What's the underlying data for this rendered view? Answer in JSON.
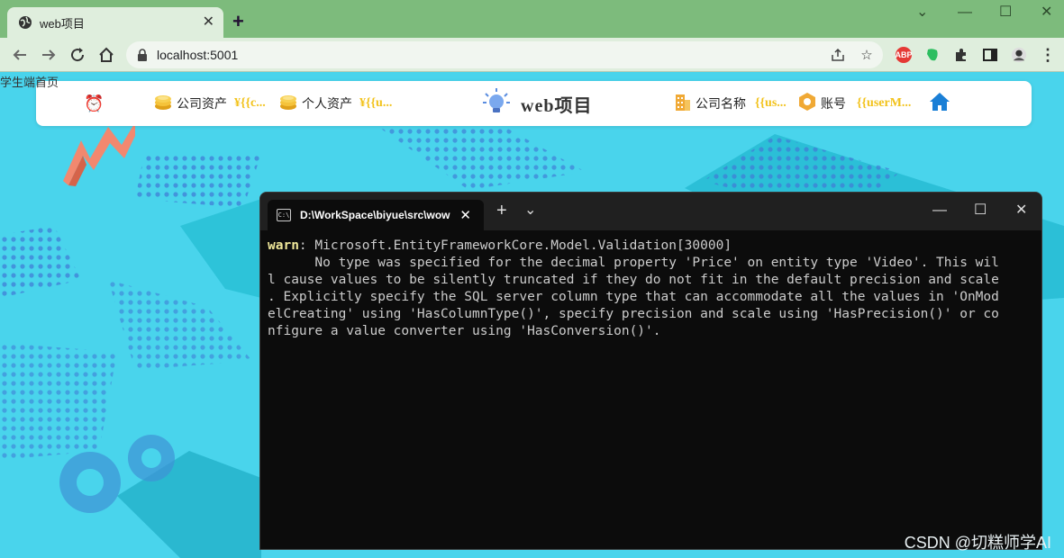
{
  "browser": {
    "tab_title": "web项目",
    "new_tab": "+",
    "url": "localhost:5001",
    "window_controls": [
      "⌄",
      "—",
      "☐",
      "✕"
    ],
    "extensions": [
      "ABP",
      "evernote",
      "puzzle",
      "sidebar",
      "avatar"
    ],
    "menu": "⋮"
  },
  "page": {
    "label": "学生端首页",
    "navbar": {
      "alarm_icon": "⏰",
      "company_assets_label": "公司资产",
      "company_assets_value": "¥{{c...",
      "personal_assets_label": "个人资产",
      "personal_assets_value": "¥{{u...",
      "brand": "web项目",
      "company_name_label": "公司名称",
      "company_name_value": "{{us...",
      "account_label": "账号",
      "account_value": "{{userM..."
    }
  },
  "terminal": {
    "tab_title": "D:\\WorkSpace\\biyue\\src\\wow",
    "close": "✕",
    "new_tab": "+",
    "dropdown": "⌄",
    "minimize": "—",
    "maximize": "☐",
    "window_close": "✕",
    "warn_prefix": "warn",
    "first_line_rest": ": Microsoft.EntityFrameworkCore.Model.Validation[30000]",
    "lines": [
      "      No type was specified for the decimal property 'Price' on entity type 'Video'. This wil",
      "l cause values to be silently truncated if they do not fit in the default precision and scale",
      ". Explicitly specify the SQL server column type that can accommodate all the values in 'OnMod",
      "elCreating' using 'HasColumnType()', specify precision and scale using 'HasPrecision()' or co",
      "nfigure a value converter using 'HasConversion()'."
    ]
  },
  "watermark": "CSDN @切糕师学AI"
}
